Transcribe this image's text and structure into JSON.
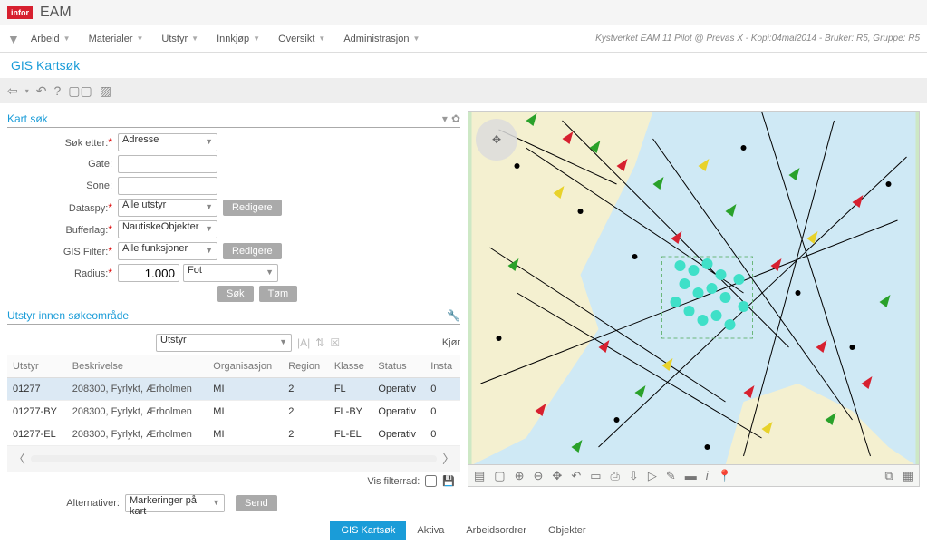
{
  "header": {
    "logo": "infor",
    "title": "EAM"
  },
  "menubar": {
    "items": [
      "Arbeid",
      "Materialer",
      "Utstyr",
      "Innkjøp",
      "Oversikt",
      "Administrasjon"
    ],
    "context": "Kystverket EAM 11 Pilot @ Prevas X - Kopi:04mai2014 - Bruker: R5, Gruppe: R5"
  },
  "page_title": "GIS Kartsøk",
  "kart_sok": {
    "title": "Kart søk",
    "labels": {
      "sok_etter": "Søk etter:",
      "gate": "Gate:",
      "sone": "Sone:",
      "dataspy": "Dataspy:",
      "bufferlag": "Bufferlag:",
      "gis_filter": "GIS Filter:",
      "radius": "Radius:"
    },
    "values": {
      "sok_etter": "Adresse",
      "gate": "",
      "sone": "",
      "dataspy": "Alle utstyr",
      "bufferlag": "NautiskeObjekter",
      "gis_filter": "Alle funksjoner",
      "radius_value": "1.000",
      "radius_unit": "Fot"
    },
    "buttons": {
      "redigere": "Redigere",
      "sok": "Søk",
      "tom": "Tøm"
    }
  },
  "result": {
    "title": "Utstyr innen søkeområde",
    "type_select": "Utstyr",
    "run": "Kjør",
    "columns": [
      "Utstyr",
      "Beskrivelse",
      "Organisasjon",
      "Region",
      "Klasse",
      "Status",
      "Insta"
    ],
    "rows": [
      {
        "utstyr": "01277",
        "beskrivelse": "208300, Fyrlykt, Ærholmen",
        "org": "MI",
        "region": "2",
        "klasse": "FL",
        "status": "Operativ",
        "insta": "0"
      },
      {
        "utstyr": "01277-BY",
        "beskrivelse": "208300, Fyrlykt, Ærholmen",
        "org": "MI",
        "region": "2",
        "klasse": "FL-BY",
        "status": "Operativ",
        "insta": "0"
      },
      {
        "utstyr": "01277-EL",
        "beskrivelse": "208300, Fyrlykt, Ærholmen",
        "org": "MI",
        "region": "2",
        "klasse": "FL-EL",
        "status": "Operativ",
        "insta": "0"
      }
    ],
    "filter_label": "Vis filterrad:",
    "alternativer_label": "Alternativer:",
    "alternativer_value": "Markeringer på kart",
    "send": "Send"
  },
  "bottom_tabs": [
    "GIS Kartsøk",
    "Aktiva",
    "Arbeidsordrer",
    "Objekter"
  ]
}
